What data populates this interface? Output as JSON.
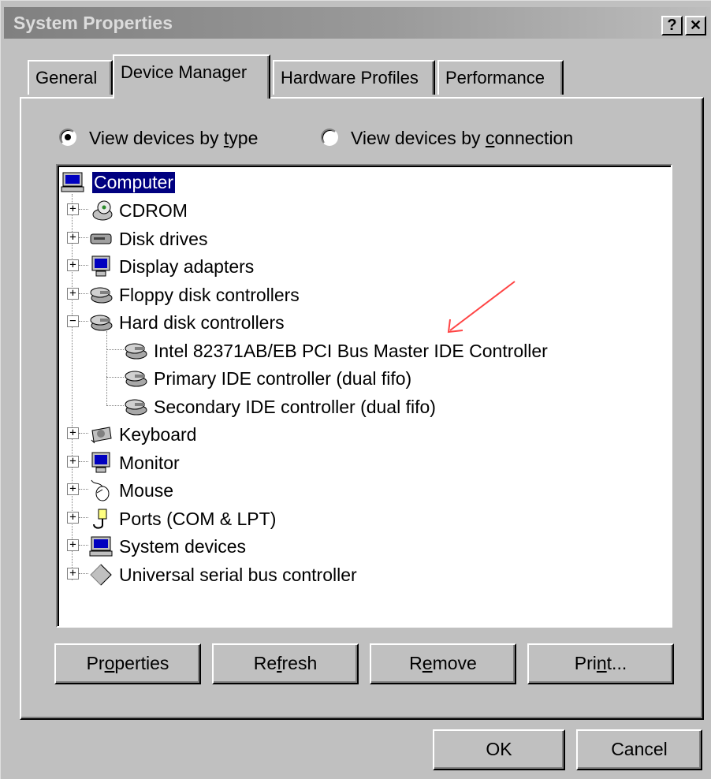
{
  "window": {
    "title": "System Properties",
    "help_label": "?",
    "close_label": "✕"
  },
  "tabs": [
    {
      "label": "General"
    },
    {
      "label": "Device Manager"
    },
    {
      "label": "Hardware Profiles"
    },
    {
      "label": "Performance"
    }
  ],
  "view_options": {
    "by_type": {
      "pre": "View devices by ",
      "mn": "t",
      "post": "ype",
      "selected": true
    },
    "by_connection": {
      "pre": "View devices by ",
      "mn": "c",
      "post": "onnection",
      "selected": false
    }
  },
  "tree": {
    "root": {
      "label": "Computer",
      "icon": "computer-icon",
      "selected": true
    },
    "items": [
      {
        "label": "CDROM",
        "icon": "cdrom-icon",
        "expanded": false
      },
      {
        "label": "Disk drives",
        "icon": "disk-drive-icon",
        "expanded": false
      },
      {
        "label": "Display adapters",
        "icon": "monitor-icon",
        "expanded": false
      },
      {
        "label": "Floppy disk controllers",
        "icon": "controller-icon",
        "expanded": false
      },
      {
        "label": "Hard disk controllers",
        "icon": "controller-icon",
        "expanded": true,
        "children": [
          {
            "label": "Intel 82371AB/EB PCI Bus Master IDE Controller",
            "icon": "controller-icon"
          },
          {
            "label": "Primary IDE controller (dual fifo)",
            "icon": "controller-icon"
          },
          {
            "label": "Secondary IDE controller (dual fifo)",
            "icon": "controller-icon"
          }
        ]
      },
      {
        "label": "Keyboard",
        "icon": "keyboard-icon",
        "expanded": false
      },
      {
        "label": "Monitor",
        "icon": "monitor-icon",
        "expanded": false
      },
      {
        "label": "Mouse",
        "icon": "mouse-icon",
        "expanded": false
      },
      {
        "label": "Ports (COM & LPT)",
        "icon": "port-icon",
        "expanded": false
      },
      {
        "label": "System devices",
        "icon": "computer-icon",
        "expanded": false
      },
      {
        "label": "Universal serial bus controller",
        "icon": "usb-diamond-icon",
        "expanded": false
      }
    ]
  },
  "buttons": {
    "properties": {
      "pre": "Pr",
      "mn": "o",
      "post": "perties"
    },
    "refresh": {
      "pre": "Re",
      "mn": "f",
      "post": "resh"
    },
    "remove": {
      "pre": "R",
      "mn": "e",
      "post": "move"
    },
    "print": {
      "pre": "Pri",
      "mn": "n",
      "post": "t..."
    },
    "ok": {
      "label": "OK"
    },
    "cancel": {
      "label": "Cancel"
    }
  },
  "annotation": {
    "color": "#ff4444",
    "icon": "red-arrow"
  },
  "colors": {
    "selection": "#000080",
    "face": "#c0c0c0"
  }
}
